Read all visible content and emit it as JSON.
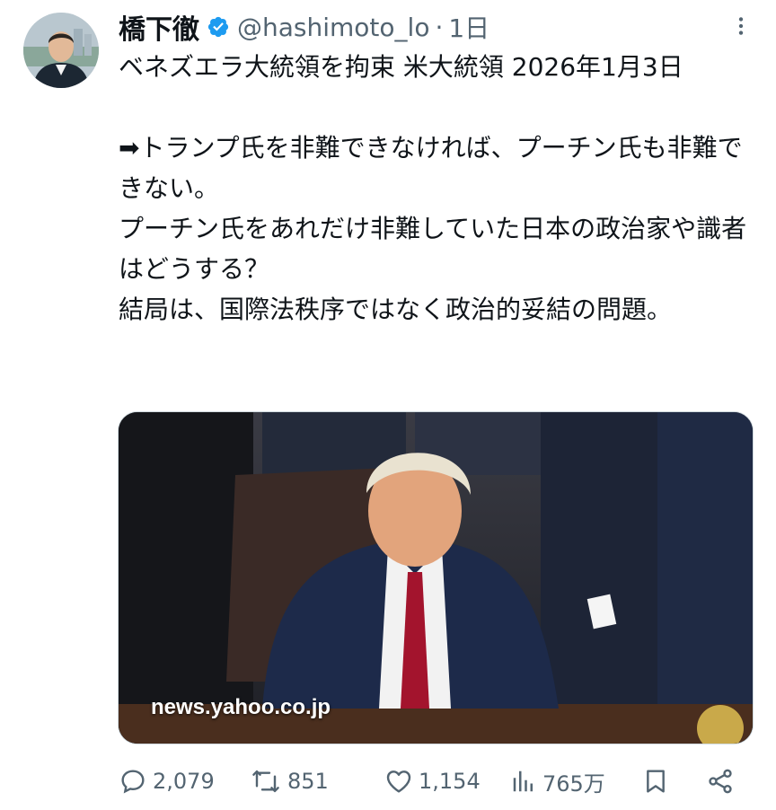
{
  "tweet": {
    "author": {
      "display_name": "橋下徹",
      "handle": "@hashimoto_lo",
      "verified": true
    },
    "separator": "·",
    "time": "1日",
    "text_lines": {
      "l1": "ベネズエラ大統領を拘束 米大統領 2026年1月3日",
      "l2": "➡トランプ氏を非難できなければ、プーチン氏も非難できない。",
      "l3": "プーチン氏をあれだけ非難していた日本の政治家や識者はどうする？",
      "l4": "結局は、国際法秩序ではなく政治的妥結の問題。"
    },
    "media": {
      "source_label": "news.yahoo.co.jp"
    },
    "metrics": {
      "replies": "2,079",
      "retweets": "851",
      "likes": "1,154",
      "views": "765万"
    }
  },
  "icons": {
    "verified": "verified-badge-icon",
    "more": "more-icon",
    "reply": "reply-icon",
    "retweet": "retweet-icon",
    "like": "heart-icon",
    "views": "views-icon",
    "bookmark": "bookmark-icon",
    "share": "share-icon"
  },
  "colors": {
    "verified_blue": "#1d9bf0",
    "secondary_text": "#536471",
    "primary_text": "#0f1419"
  }
}
